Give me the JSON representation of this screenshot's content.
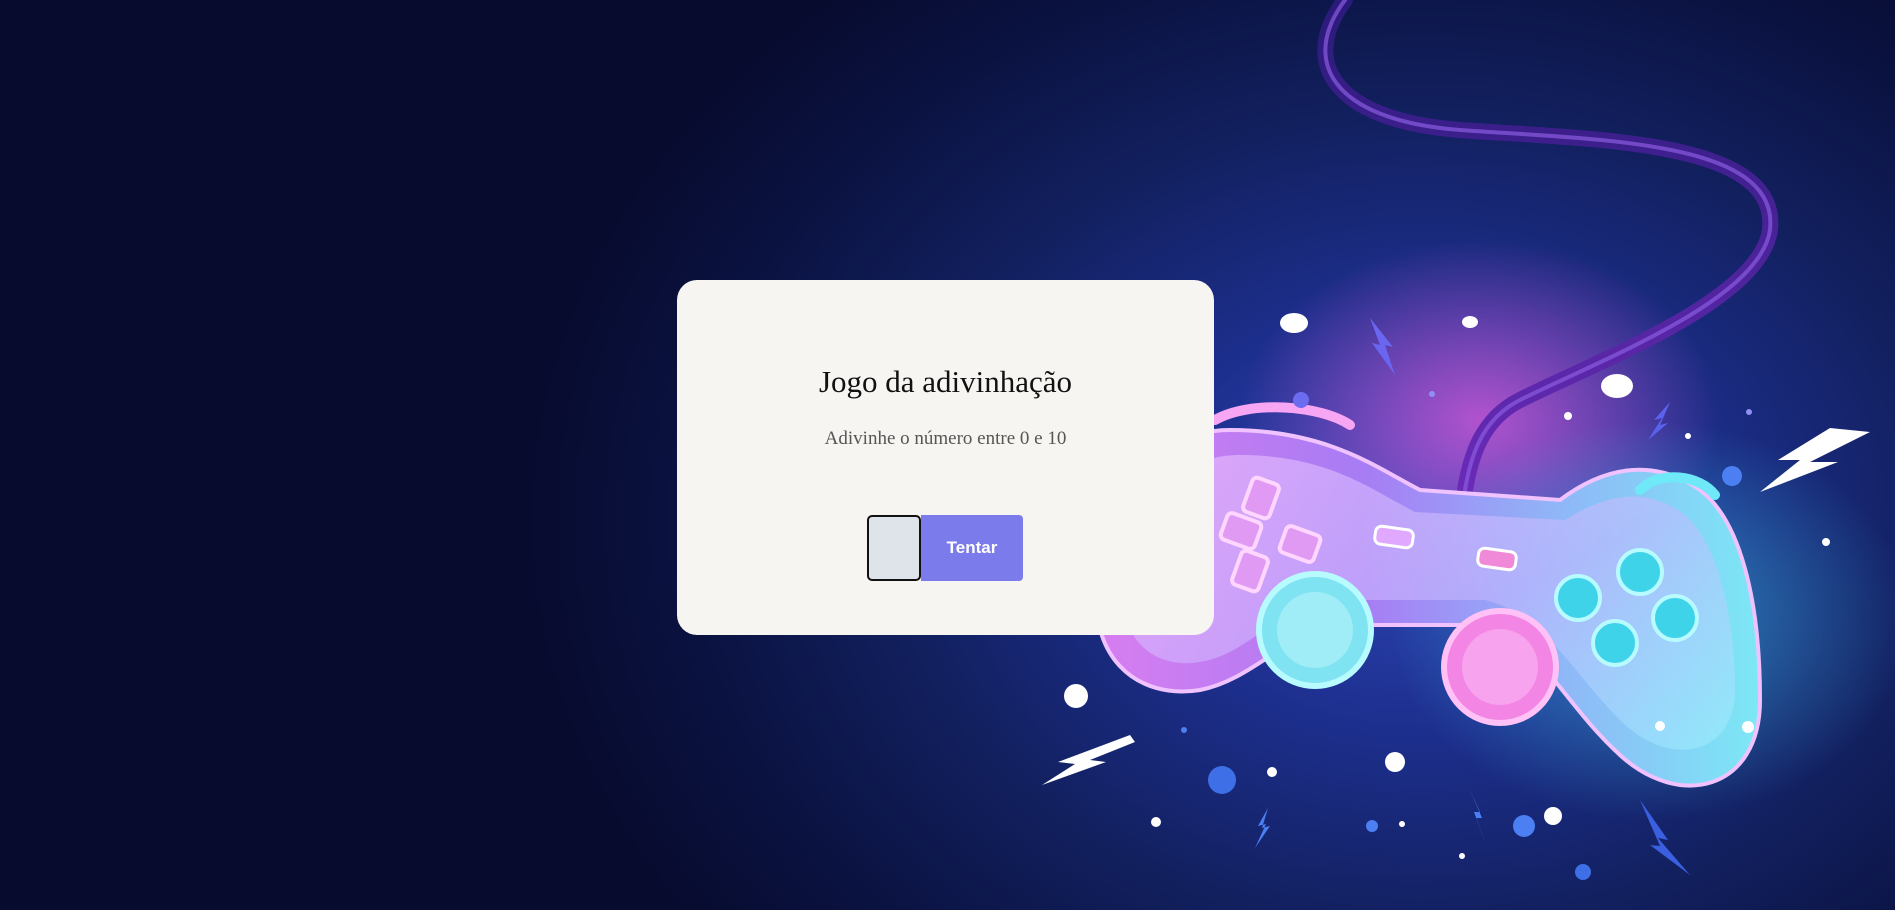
{
  "game": {
    "title": "Jogo da adivinhação",
    "subtitle": "Adivinhe o número entre 0 e 10",
    "input_value": "",
    "button_label": "Tentar"
  },
  "background": {
    "illustration": "neon-gamepad-illustration",
    "colors": {
      "deep_navy": "#070b2e",
      "royal_blue": "#1d2f8e",
      "neon_pink": "#e56ae8",
      "neon_cyan": "#4fe3f2",
      "neon_violet": "#9a6cf3"
    }
  },
  "colors": {
    "card_background": "#f7f5f2",
    "button_background": "#7b7bec",
    "input_background": "#dfe3ea"
  }
}
